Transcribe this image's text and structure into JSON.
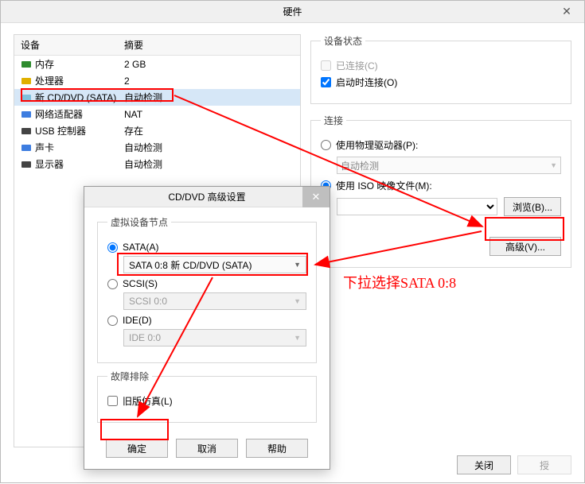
{
  "window": {
    "title": "硬件",
    "close_icon": "✕"
  },
  "device_table": {
    "col_device": "设备",
    "col_summary": "摘要",
    "rows": [
      {
        "id": "memory",
        "name": "内存",
        "summary": "2 GB",
        "selected": false,
        "icon_color": "#2e8b2e"
      },
      {
        "id": "cpu",
        "name": "处理器",
        "summary": "2",
        "selected": false,
        "icon_color": "#e0b000"
      },
      {
        "id": "cddvd",
        "name": "新 CD/DVD (SATA)",
        "summary": "自动检测",
        "selected": true,
        "icon_color": "#7fbfdc"
      },
      {
        "id": "nic",
        "name": "网络适配器",
        "summary": "NAT",
        "selected": false,
        "icon_color": "#3d7de0"
      },
      {
        "id": "usb",
        "name": "USB 控制器",
        "summary": "存在",
        "selected": false,
        "icon_color": "#444444"
      },
      {
        "id": "sound",
        "name": "声卡",
        "summary": "自动检测",
        "selected": false,
        "icon_color": "#3d7de0"
      },
      {
        "id": "display",
        "name": "显示器",
        "summary": "自动检测",
        "selected": false,
        "icon_color": "#444444"
      }
    ]
  },
  "device_status": {
    "legend": "设备状态",
    "connected": {
      "label": "已连接(C)",
      "checked": false,
      "disabled": true
    },
    "connect_on_boot": {
      "label": "启动时连接(O)",
      "checked": true
    }
  },
  "connection": {
    "legend": "连接",
    "use_physical": {
      "label": "使用物理驱动器(P):",
      "checked": false
    },
    "auto_detect": "自动检测",
    "use_iso": {
      "label": "使用 ISO 映像文件(M):",
      "checked": true
    },
    "iso_value": "",
    "browse_label": "浏览(B)..."
  },
  "advanced_label": "高级(V)...",
  "footer": {
    "close": "关闭",
    "help_partial": "授"
  },
  "subdialog": {
    "title": "CD/DVD 高级设置",
    "virtual_node": "虚拟设备节点",
    "sata": {
      "label": "SATA(A)",
      "checked": true,
      "value": "SATA 0:8  新 CD/DVD (SATA)"
    },
    "scsi": {
      "label": "SCSI(S)",
      "checked": false,
      "value": "SCSI 0:0"
    },
    "ide": {
      "label": "IDE(D)",
      "checked": false,
      "value": "IDE 0:0"
    },
    "troubleshoot": "故障排除",
    "legacy": {
      "label": "旧版仿真(L)",
      "checked": false
    },
    "ok": "确定",
    "cancel": "取消",
    "help": "帮助"
  },
  "annotations": {
    "dropdown_note": "下拉选择SATA 0:8"
  }
}
